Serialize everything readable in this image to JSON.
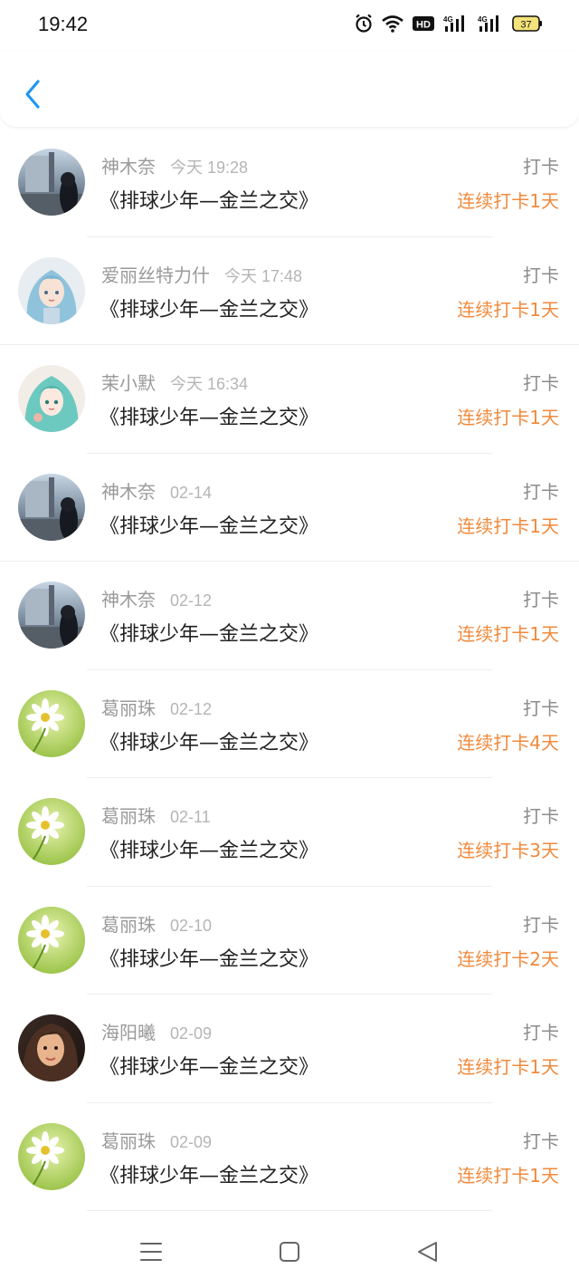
{
  "status_bar": {
    "time": "19:42",
    "battery": "37",
    "icons": [
      "alarm-icon",
      "wifi-icon",
      "hd-icon",
      "signal-4g-icon",
      "signal-4g-icon",
      "battery-icon"
    ]
  },
  "header": {
    "back_icon": "chevron-left-icon"
  },
  "colors": {
    "accent": "#f08a3c",
    "back": "#2196f3"
  },
  "records": [
    {
      "name": "神木奈",
      "date": "今天 19:28",
      "title": "《排球少年—金兰之交》",
      "action": "打卡",
      "streak": "连续打卡1天",
      "avatar": "street"
    },
    {
      "name": "爱丽丝特力什",
      "date": "今天 17:48",
      "title": "《排球少年—金兰之交》",
      "action": "打卡",
      "streak": "连续打卡1天",
      "avatar": "anime-blue"
    },
    {
      "name": "茉小默",
      "date": "今天 16:34",
      "title": "《排球少年—金兰之交》",
      "action": "打卡",
      "streak": "连续打卡1天",
      "avatar": "anime-teal"
    },
    {
      "name": "神木奈",
      "date": "02-14",
      "title": "《排球少年—金兰之交》",
      "action": "打卡",
      "streak": "连续打卡1天",
      "avatar": "street"
    },
    {
      "name": "神木奈",
      "date": "02-12",
      "title": "《排球少年—金兰之交》",
      "action": "打卡",
      "streak": "连续打卡1天",
      "avatar": "street"
    },
    {
      "name": "葛丽珠",
      "date": "02-12",
      "title": "《排球少年—金兰之交》",
      "action": "打卡",
      "streak": "连续打卡4天",
      "avatar": "daisy"
    },
    {
      "name": "葛丽珠",
      "date": "02-11",
      "title": "《排球少年—金兰之交》",
      "action": "打卡",
      "streak": "连续打卡3天",
      "avatar": "daisy"
    },
    {
      "name": "葛丽珠",
      "date": "02-10",
      "title": "《排球少年—金兰之交》",
      "action": "打卡",
      "streak": "连续打卡2天",
      "avatar": "daisy"
    },
    {
      "name": "海阳曦",
      "date": "02-09",
      "title": "《排球少年—金兰之交》",
      "action": "打卡",
      "streak": "连续打卡1天",
      "avatar": "portrait"
    },
    {
      "name": "葛丽珠",
      "date": "02-09",
      "title": "《排球少年—金兰之交》",
      "action": "打卡",
      "streak": "连续打卡1天",
      "avatar": "daisy"
    }
  ],
  "nav": {
    "icons": [
      "menu-icon",
      "home-square-icon",
      "back-triangle-icon"
    ]
  }
}
